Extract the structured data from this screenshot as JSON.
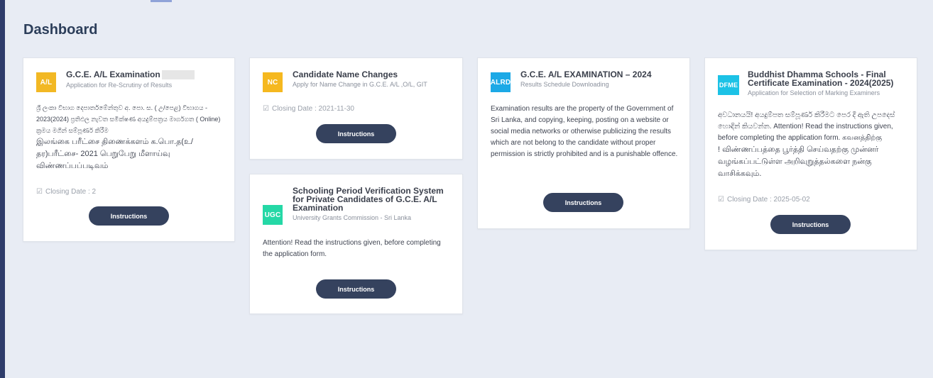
{
  "page": {
    "title": "Dashboard"
  },
  "cards": [
    {
      "badge": "A/L",
      "badge_color": "#f2b824",
      "title": "G.C.E. A/L Examination",
      "subtitle": "Application for Re-Scrutiny of Results",
      "body_si": "ශ්‍රී ලංකා විභාග දෙපාර්තමේන්තුව අ. පො. ස. ( උ/පෙළ) විභාගය - 2023(2024) ප්‍රතිඵල නැවත සමීක්ෂණ අයදුම්පත්‍රය මාර්ගගත ( Online) ක්‍රමය මගින් සම්පූර්ණ කිරීම",
      "body_ta": "இலங்கை பரீட்சை திணைக்களம் க.பொ.த(உ/தர)பரீட்சை- 2021 பெறுபேறு மீளாய்வு விண்ணப்பப்படிவம்",
      "closing": "Closing Date : 2",
      "button": "Instructions"
    },
    {
      "badge": "NC",
      "badge_color": "#f5b81f",
      "title": "Candidate Name Changes",
      "subtitle": "Apply for Name Change in G.C.E. A/L ,O/L, GIT",
      "closing": "Closing Date : 2021-11-30",
      "button": "Instructions"
    },
    {
      "badge": "UGC",
      "badge_color": "#25d8a6",
      "title": "Schooling Period Verification System for Private Candidates of G.C.E. A/L Examination",
      "subtitle": "University Grants Commission - Sri Lanka",
      "body": "Attention! Read the instructions given, before completing the application form.",
      "button": "Instructions"
    },
    {
      "badge": "ALRD",
      "badge_color": "#1ca9e6",
      "title": "G.C.E. A/L EXAMINATION – 2024",
      "subtitle": "Results Schedule Downloading",
      "body": "Examination results are the property of the Government of Sri Lanka, and copying, keeping, posting on a website or social media networks or otherwise publicizing the results which are not belong to the candidate without proper permission is strictly prohibited and is a punishable offence.",
      "button": "Instructions"
    },
    {
      "badge": "DFME",
      "badge_color": "#1cc2e6",
      "title": "Buddhist Dhamma Schools - Final Certificate Examination - 2024(2025)",
      "subtitle": "Application for Selection of Marking Examiners",
      "body_si": "අවධානයයි! අයදුම්පත සම්පූර්ණ කිරීමට පෙර දී ඇති උපදෙස් හොඳින් කියවන්න. Attention! Read the instructions given, before completing the application form. கவனத்திற்கு",
      "body_ta": "! விண்ணப்பத்தை பூர்த்தி செய்வதற்கு முன்னர் வழங்கப்பட்டுள்ள அறிவுறுத்தல்களை நன்கு வாசிக்கவும்.",
      "closing": "Closing Date : 2025-05-02",
      "button": "Instructions"
    }
  ]
}
